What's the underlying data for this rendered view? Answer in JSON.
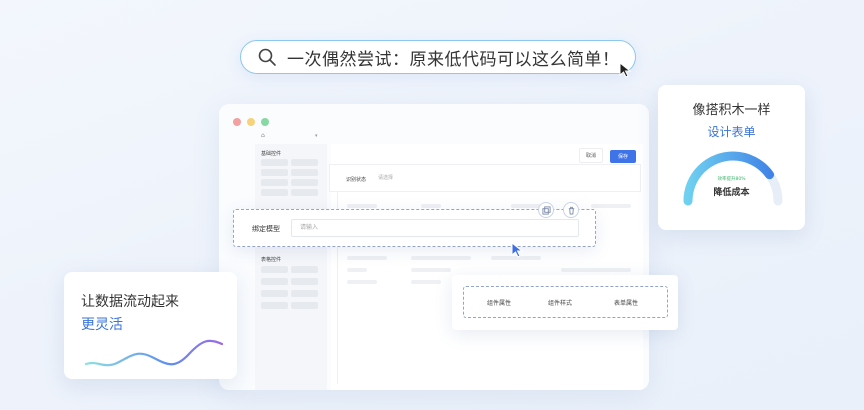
{
  "search": {
    "text": "一次偶然尝试：原来低代码可以这么简单！"
  },
  "window": {
    "home_icon": "home-icon",
    "sidebar": {
      "group1_title": "基础控件",
      "group2_title": "表格控件"
    },
    "toolbar": {
      "cancel_label": "取消",
      "save_label": "保存"
    },
    "form_row": {
      "label": "识别状态",
      "placeholder": "请选择"
    }
  },
  "bind_card": {
    "label": "绑定模型",
    "placeholder": "请输入",
    "copy_icon": "copy-icon",
    "delete_icon": "trash-icon"
  },
  "props_card": {
    "tabs": [
      "组件属性",
      "组件样式",
      "表单属性"
    ]
  },
  "top_right_card": {
    "title": "像搭积木一样",
    "subtitle": "设计表单",
    "gauge_small": "效率提升80%",
    "gauge_main": "降低成本",
    "gauge_level": 0.8
  },
  "bottom_left_card": {
    "title": "让数据流动起来",
    "subtitle": "更灵活"
  },
  "colors": {
    "accent": "#3a73dc",
    "save_button": "#3f73e8",
    "gauge_start": "#6fd0f0",
    "gauge_end": "#3d7de6",
    "dot_red": "#f2a0a0",
    "dot_yellow": "#f6d27a",
    "dot_green": "#86d9a4"
  }
}
